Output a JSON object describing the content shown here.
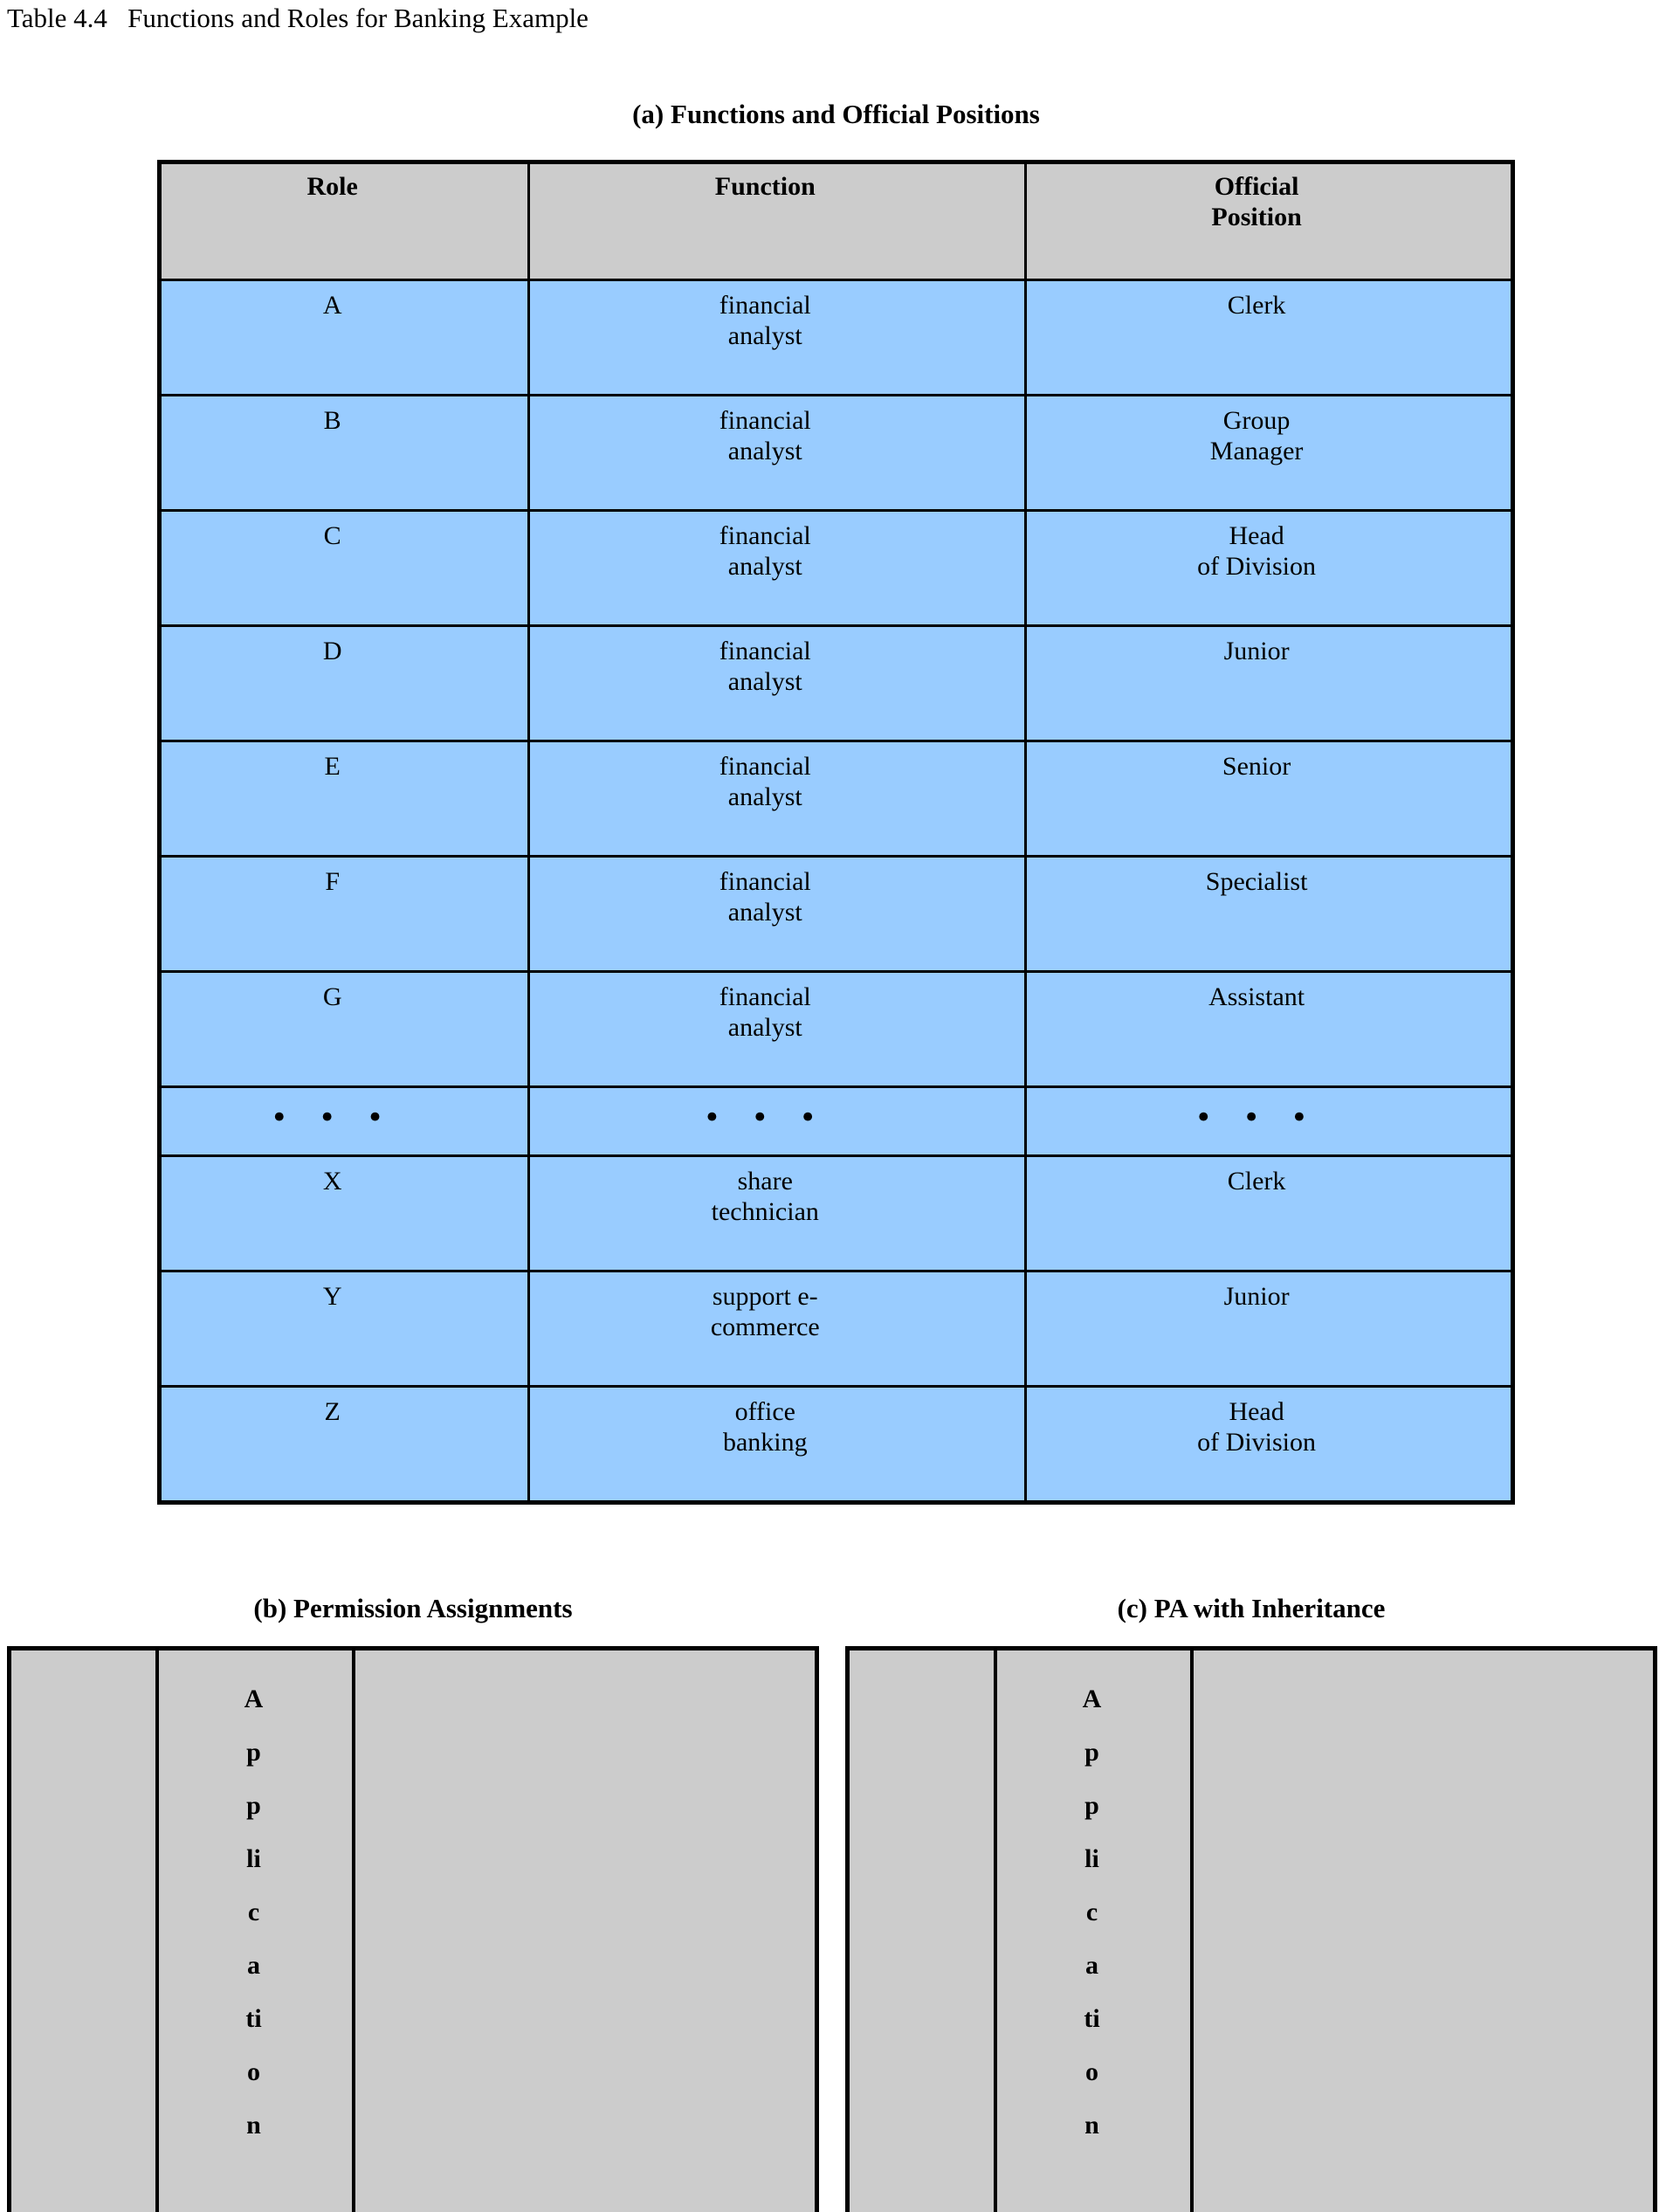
{
  "table_caption": "Table 4.4   Functions and Roles for Banking Example",
  "part_a": {
    "title": "(a) Functions and Official Positions",
    "headers": [
      "Role",
      "Function",
      "Official\nPosition"
    ],
    "header_role": "Role",
    "header_function": "Function",
    "header_position_line1": "Official",
    "header_position_line2": "Position",
    "rows": [
      {
        "role": "A",
        "function": "financial analyst",
        "position": "Clerk"
      },
      {
        "role": "B",
        "function": "financial analyst",
        "position": "Group Manager"
      },
      {
        "role": "C",
        "function": "financial analyst",
        "position": "Head of Division"
      },
      {
        "role": "D",
        "function": "financial analyst",
        "position": "Junior"
      },
      {
        "role": "E",
        "function": "financial analyst",
        "position": "Senior"
      },
      {
        "role": "F",
        "function": "financial analyst",
        "position": "Specialist"
      },
      {
        "role": "G",
        "function": "financial analyst",
        "position": "Assistant"
      },
      {
        "role": "• • •",
        "function": "• • •",
        "position": "• • •",
        "is_ellipsis": true
      },
      {
        "role": "X",
        "function": "share technician",
        "position": "Clerk"
      },
      {
        "role": "Y",
        "function": "support e-commerce",
        "position": "Junior"
      },
      {
        "role": "Z",
        "function": "office banking",
        "position": "Head of Division"
      }
    ]
  },
  "part_b": {
    "title": "(b) Permission Assignments",
    "vertical_label": "Application",
    "vertical_label_lines": [
      "A",
      "p",
      "p",
      "li",
      "c",
      "a",
      "ti",
      "o",
      "n"
    ]
  },
  "part_c": {
    "title": "(c) PA with Inheritance",
    "vertical_label": "Application",
    "vertical_label_lines": [
      "A",
      "p",
      "p",
      "li",
      "c",
      "a",
      "ti",
      "o",
      "n"
    ]
  },
  "colors": {
    "header_fill": "#cccccc",
    "body_fill": "#99ccff",
    "panel_fill": "#cccccc",
    "border": "#000000",
    "text": "#000000",
    "background": "#ffffff"
  }
}
